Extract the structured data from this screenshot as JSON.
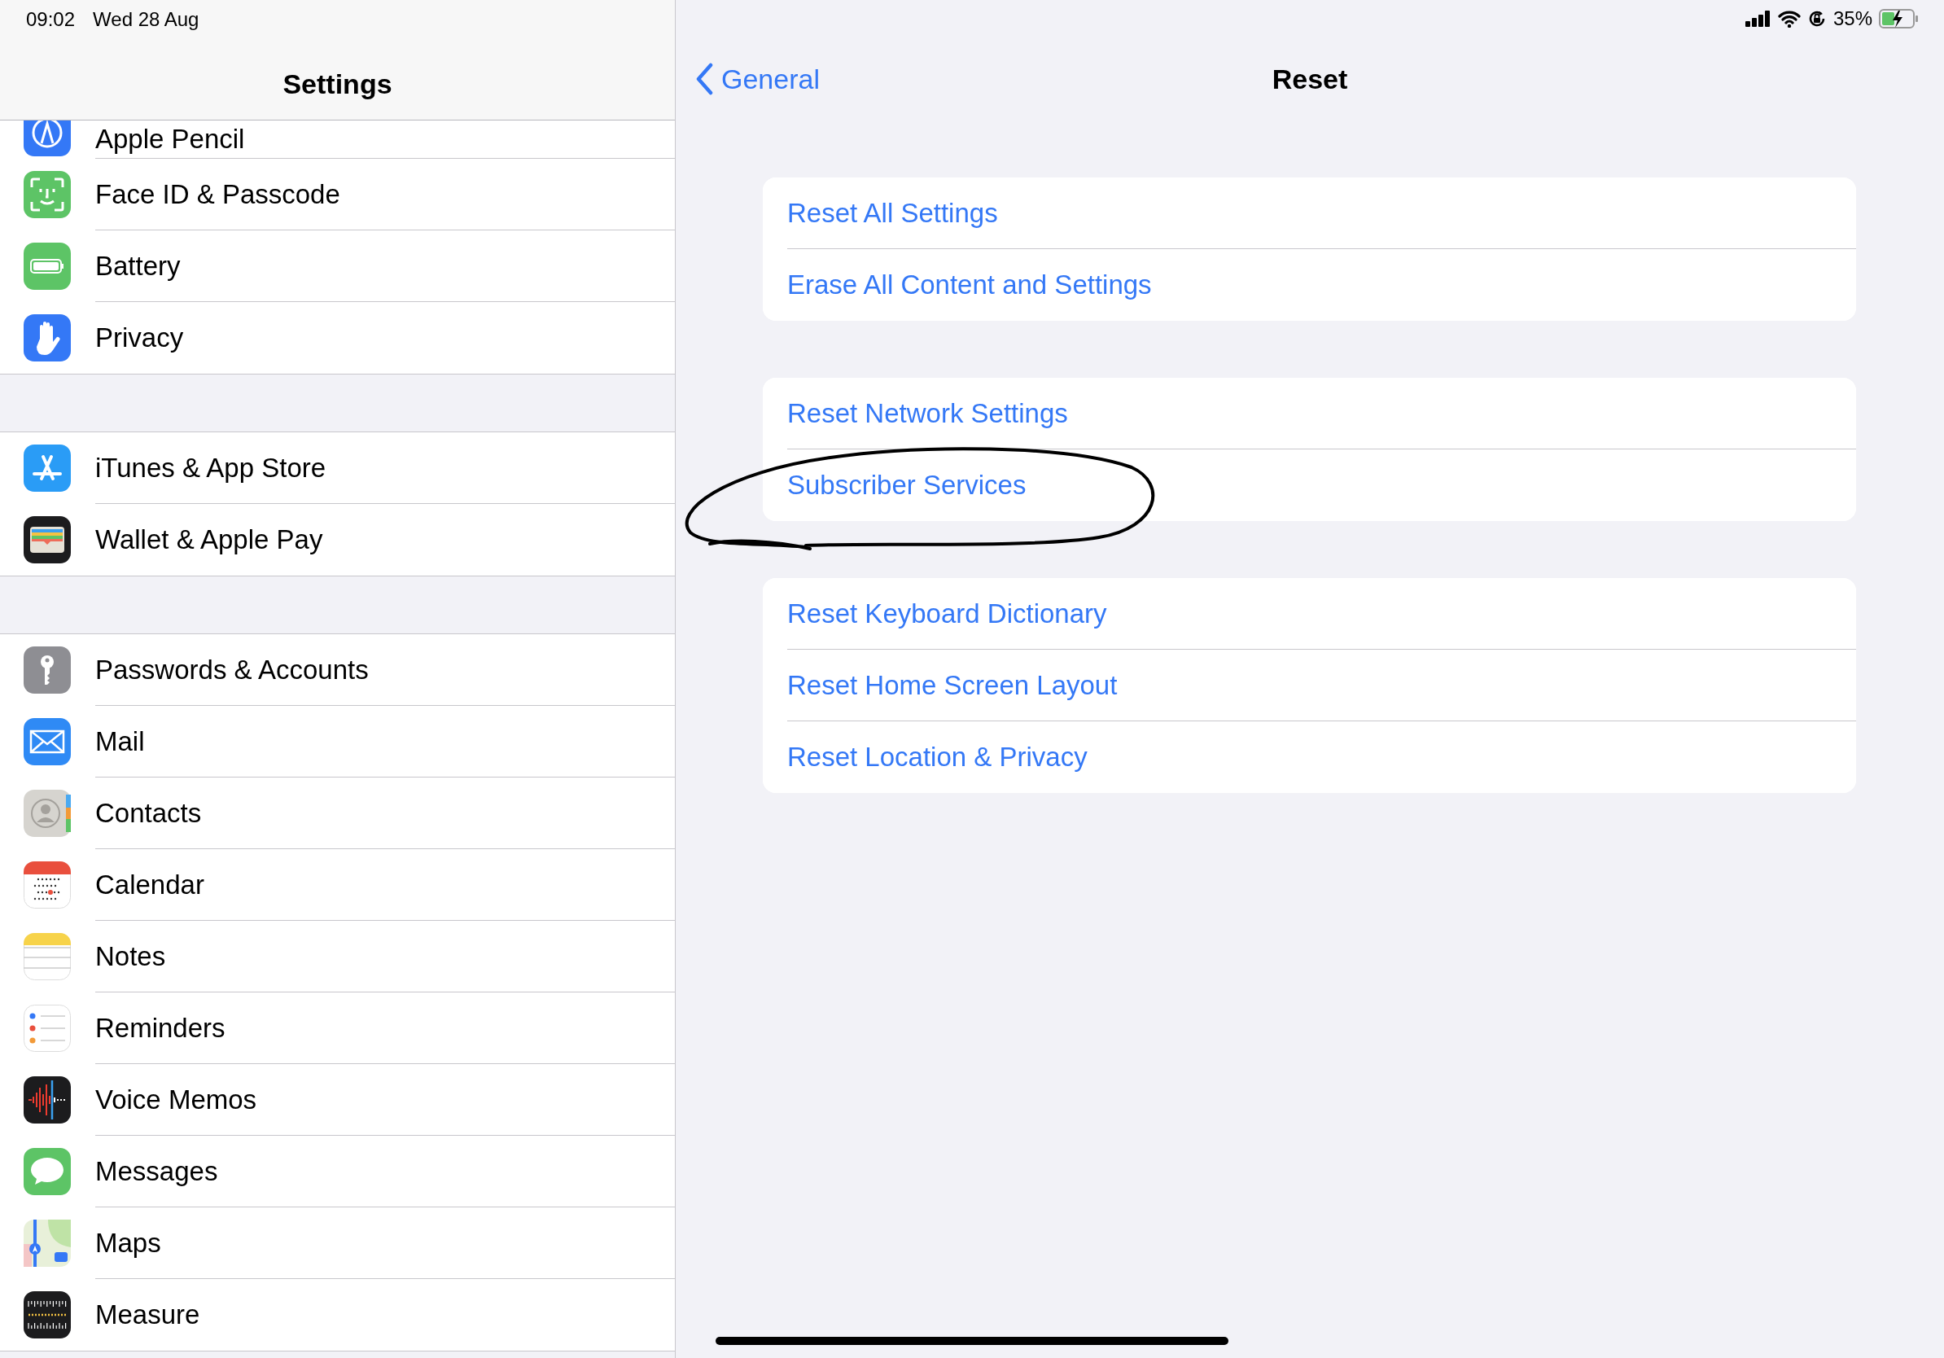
{
  "status_bar": {
    "time": "09:02",
    "date": "Wed 28 Aug",
    "battery_text": "35%"
  },
  "sidebar": {
    "title": "Settings",
    "sections": [
      {
        "items": [
          {
            "label": "Apple Pencil"
          },
          {
            "label": "Face ID & Passcode"
          },
          {
            "label": "Battery"
          },
          {
            "label": "Privacy"
          }
        ]
      },
      {
        "items": [
          {
            "label": "iTunes & App Store"
          },
          {
            "label": "Wallet & Apple Pay"
          }
        ]
      },
      {
        "items": [
          {
            "label": "Passwords & Accounts"
          },
          {
            "label": "Mail"
          },
          {
            "label": "Contacts"
          },
          {
            "label": "Calendar"
          },
          {
            "label": "Notes"
          },
          {
            "label": "Reminders"
          },
          {
            "label": "Voice Memos"
          },
          {
            "label": "Messages"
          },
          {
            "label": "Maps"
          },
          {
            "label": "Measure"
          }
        ]
      }
    ]
  },
  "nav": {
    "back": "General",
    "title": "Reset"
  },
  "groups": [
    {
      "items": [
        "Reset All Settings",
        "Erase All Content and Settings"
      ]
    },
    {
      "items": [
        "Reset Network Settings",
        "Subscriber Services"
      ]
    },
    {
      "items": [
        "Reset Keyboard Dictionary",
        "Reset Home Screen Layout",
        "Reset Location & Privacy"
      ]
    }
  ]
}
